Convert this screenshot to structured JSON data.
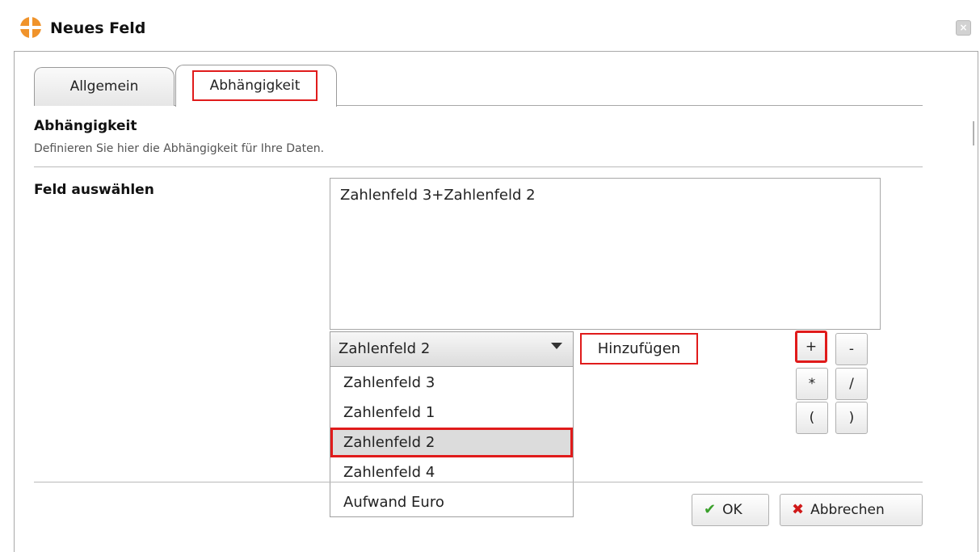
{
  "window": {
    "title": "Neues Feld",
    "logo_icon": "orange-circle-logo-icon",
    "close_label": "×"
  },
  "tabs": [
    {
      "label": "Allgemein",
      "active": false
    },
    {
      "label": "Abhängigkeit",
      "active": true
    }
  ],
  "section": {
    "title": "Abhängigkeit",
    "description": "Definieren Sie hier die Abhängigkeit für Ihre Daten."
  },
  "field": {
    "label": "Feld auswählen",
    "formula_value": "Zahlenfeld 3+Zahlenfeld 2",
    "selected_value": "Zahlenfeld 2",
    "options": [
      "Zahlenfeld 3",
      "Zahlenfeld 1",
      "Zahlenfeld 2",
      "Zahlenfeld 4",
      "Aufwand Euro"
    ],
    "add_label": "Hinzufügen"
  },
  "operators": [
    "+",
    "-",
    "*",
    "/",
    "(",
    ")"
  ],
  "buttons": {
    "ok_label": "OK",
    "cancel_label": "Abbrechen"
  },
  "colors": {
    "highlight": "#e01b1b",
    "ok_check": "#3aa02b",
    "cancel_x": "#d01919",
    "logo_orange": "#f0932b"
  }
}
